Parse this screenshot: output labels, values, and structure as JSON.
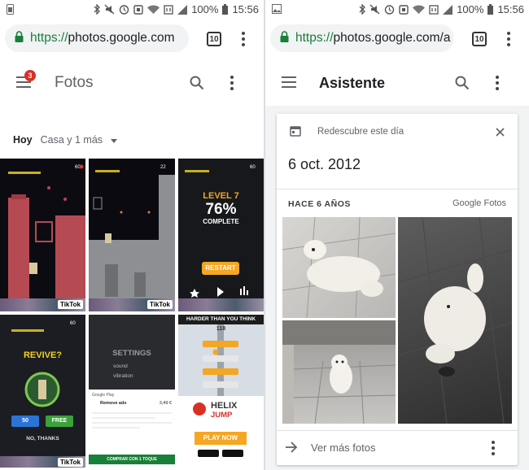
{
  "status_bar": {
    "battery": "100%",
    "time": "15:56"
  },
  "left": {
    "url_scheme": "https://",
    "url_host": "photos.google.com",
    "tab_count": "10",
    "notification_count": "3",
    "app_title": "Fotos",
    "filter_today": "Hoy",
    "filter_place": "Casa y 1 más",
    "tiles": [
      {
        "name": "game-screenshot-1",
        "text": "",
        "badge": "TikTok"
      },
      {
        "name": "game-screenshot-2",
        "text": "",
        "badge": "TikTok"
      },
      {
        "name": "game-screenshot-3",
        "line1": "LEVEL 7",
        "line2": "76%",
        "line3": "COMPLETE",
        "button": "RESTART"
      },
      {
        "name": "game-screenshot-4",
        "line1": "REVIVE?",
        "left_btn": "50",
        "right_btn": "FREE",
        "link": "NO, THANKS",
        "badge": "TikTok"
      },
      {
        "name": "game-screenshot-5",
        "line1": "SETTINGS",
        "opt1": "sound",
        "opt2": "vibration",
        "ad1": "Remove ads",
        "price": "3,49 €",
        "store": "Google Play",
        "buy": "COMPRAR CON 1 TOQUE"
      },
      {
        "name": "game-screenshot-6",
        "line1": "HARDER THAN YOU THINK",
        "score": "118",
        "logo1": "HELIX",
        "logo2": "JUMP",
        "cta": "PLAY NOW"
      }
    ]
  },
  "right": {
    "url_scheme": "https://",
    "url_host": "photos.google.com/a",
    "tab_count": "10",
    "app_title": "Asistente",
    "card": {
      "label": "Redescubre este día",
      "date": "6 oct. 2012",
      "years_ago": "HACE 6 AÑOS",
      "brand": "Google Fotos",
      "see_more": "Ver más fotos"
    }
  },
  "colors": {
    "accent_red": "#d93025",
    "lock_green": "#188038",
    "tile_orange": "#f5a623"
  }
}
